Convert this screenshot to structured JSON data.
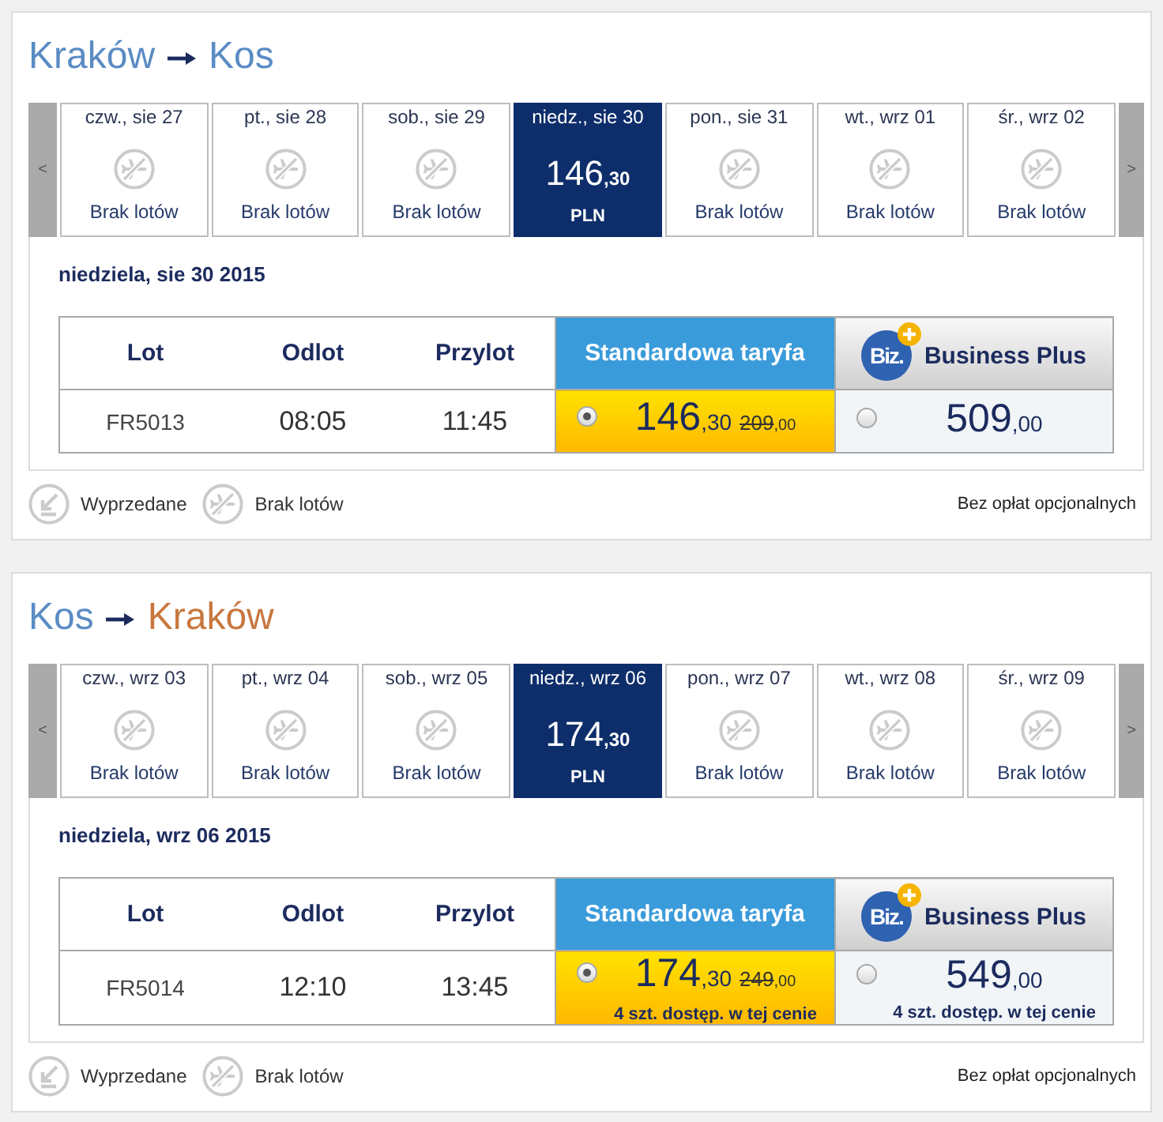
{
  "journeys": [
    {
      "title": {
        "origin": {
          "text": "Kraków",
          "highlighted": false
        },
        "destination": {
          "text": "Kos",
          "highlighted": false
        }
      },
      "dates": {
        "previous": "<",
        "next": ">",
        "days": [
          {
            "label": "czw., sie 27",
            "kind": "no_flights",
            "status": "Brak lotów",
            "selected": false
          },
          {
            "label": "pt., sie 28",
            "kind": "no_flights",
            "status": "Brak lotów",
            "selected": false
          },
          {
            "label": "sob., sie 29",
            "kind": "no_flights",
            "status": "Brak lotów",
            "selected": false
          },
          {
            "label": "niedz., sie 30",
            "kind": "price",
            "amount": "146",
            "decimals": ",30",
            "currency": "PLN",
            "selected": true
          },
          {
            "label": "pon., sie 31",
            "kind": "no_flights",
            "status": "Brak lotów",
            "selected": false
          },
          {
            "label": "wt., wrz 01",
            "kind": "no_flights",
            "status": "Brak lotów",
            "selected": false
          },
          {
            "label": "śr., wrz 02",
            "kind": "no_flights",
            "status": "Brak lotów",
            "selected": false
          }
        ]
      },
      "day_heading": "niedziela, sie 30 2015",
      "table": {
        "columns": [
          "Lot",
          "Odlot",
          "Przylot"
        ],
        "fares": [
          {
            "kind": "standard",
            "title": "Standardowa taryfa"
          },
          {
            "kind": "business",
            "title": "Business Plus",
            "logo": "Biz."
          }
        ],
        "rows": [
          {
            "flight": "FR5013",
            "departure": "08:05",
            "arrival": "11:45",
            "fares": [
              {
                "selected": true,
                "amount": "146",
                "decimals": ",30",
                "old_amount": "209",
                "old_decimals": ",00"
              },
              {
                "selected": false,
                "amount": "509",
                "decimals": ",00"
              }
            ]
          }
        ]
      },
      "legend": [
        {
          "kind": "sold_out",
          "label": "Wyprzedane"
        },
        {
          "kind": "no_flights",
          "label": "Brak lotów"
        }
      ],
      "note": "Bez opłat opcjonalnych"
    },
    {
      "title": {
        "origin": {
          "text": "Kos",
          "highlighted": false
        },
        "destination": {
          "text": "Kraków",
          "highlighted": true
        }
      },
      "dates": {
        "previous": "<",
        "next": ">",
        "days": [
          {
            "label": "czw., wrz 03",
            "kind": "no_flights",
            "status": "Brak lotów",
            "selected": false
          },
          {
            "label": "pt., wrz 04",
            "kind": "no_flights",
            "status": "Brak lotów",
            "selected": false
          },
          {
            "label": "sob., wrz 05",
            "kind": "no_flights",
            "status": "Brak lotów",
            "selected": false
          },
          {
            "label": "niedz., wrz 06",
            "kind": "price",
            "amount": "174",
            "decimals": ",30",
            "currency": "PLN",
            "selected": true
          },
          {
            "label": "pon., wrz 07",
            "kind": "no_flights",
            "status": "Brak lotów",
            "selected": false
          },
          {
            "label": "wt., wrz 08",
            "kind": "no_flights",
            "status": "Brak lotów",
            "selected": false
          },
          {
            "label": "śr., wrz 09",
            "kind": "no_flights",
            "status": "Brak lotów",
            "selected": false
          }
        ]
      },
      "day_heading": "niedziela, wrz 06 2015",
      "table": {
        "columns": [
          "Lot",
          "Odlot",
          "Przylot"
        ],
        "fares": [
          {
            "kind": "standard",
            "title": "Standardowa taryfa"
          },
          {
            "kind": "business",
            "title": "Business Plus",
            "logo": "Biz."
          }
        ],
        "rows": [
          {
            "flight": "FR5014",
            "departure": "12:10",
            "arrival": "13:45",
            "fares": [
              {
                "selected": true,
                "amount": "174",
                "decimals": ",30",
                "old_amount": "249",
                "old_decimals": ",00",
                "availability": "4 szt. dostęp. w tej cenie"
              },
              {
                "selected": false,
                "amount": "549",
                "decimals": ",00",
                "availability": "4 szt. dostęp. w tej cenie"
              }
            ]
          }
        ]
      },
      "legend": [
        {
          "kind": "sold_out",
          "label": "Wyprzedane"
        },
        {
          "kind": "no_flights",
          "label": "Brak lotów"
        }
      ],
      "note": "Bez opłat opcjonalnych"
    }
  ]
}
